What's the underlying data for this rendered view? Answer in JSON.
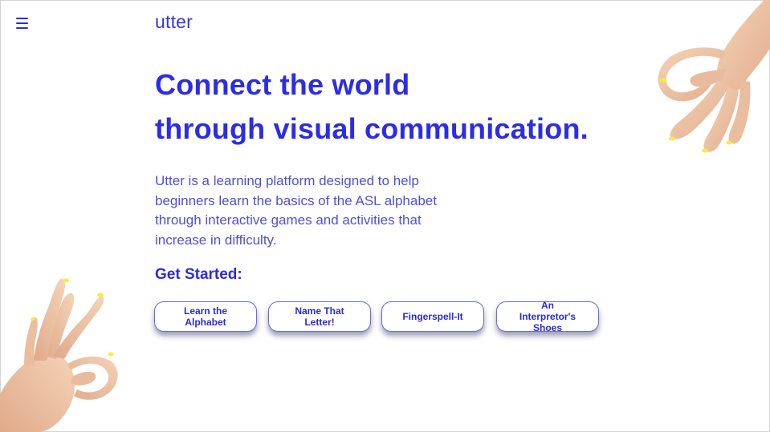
{
  "header": {
    "brand": "utter",
    "menu_icon": "hamburger-menu-icon"
  },
  "hero": {
    "headline_line1": "Connect the world",
    "headline_line2": "through visual communication.",
    "intro": "Utter is a learning platform designed to help beginners learn the basics of the ASL alphabet through interactive games and activities that increase in difficulty."
  },
  "get_started": {
    "label": "Get Started:",
    "buttons": [
      {
        "label": "Learn the Alphabet"
      },
      {
        "label": "Name That Letter!"
      },
      {
        "label": "Fingerspell-It"
      },
      {
        "label": "An Interpretor's Shoes"
      }
    ]
  },
  "decorations": {
    "top_right": "ok-hand-sign-icon",
    "bottom_left": "ok-hand-sign-icon"
  },
  "colors": {
    "accent": "#2c2ce8",
    "text": "#4f4fd6",
    "skin": "#f0c7a7",
    "nail": "#f4ee3c"
  }
}
